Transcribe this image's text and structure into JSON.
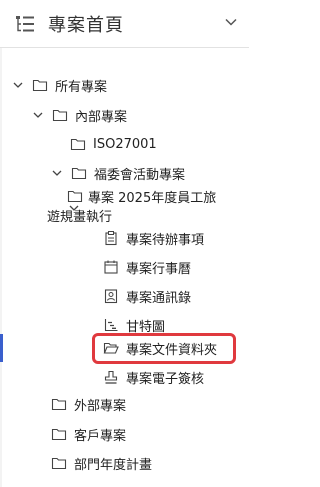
{
  "header": {
    "title": "專案首頁",
    "icon": "tree-list-icon",
    "toggle_icon": "chevron-down-icon"
  },
  "tree": {
    "root": "所有專案",
    "internal": "內部專案",
    "iso": "ISO27001",
    "welfare": "福委會活動專案",
    "project_line1": "專案 2025年度員工旅",
    "project_line2": "遊規畫執行",
    "todo": "專案待辦事項",
    "calendar": "專案行事曆",
    "contacts": "專案通訊錄",
    "gantt": "甘特圖",
    "docs": "專案文件資料夾",
    "esign": "專案電子簽核",
    "external": "外部專案",
    "client": "客戶專案",
    "dept": "部門年度計畫"
  },
  "colors": {
    "highlight": "#e0393e",
    "active_indicator": "#3a5fcd"
  }
}
